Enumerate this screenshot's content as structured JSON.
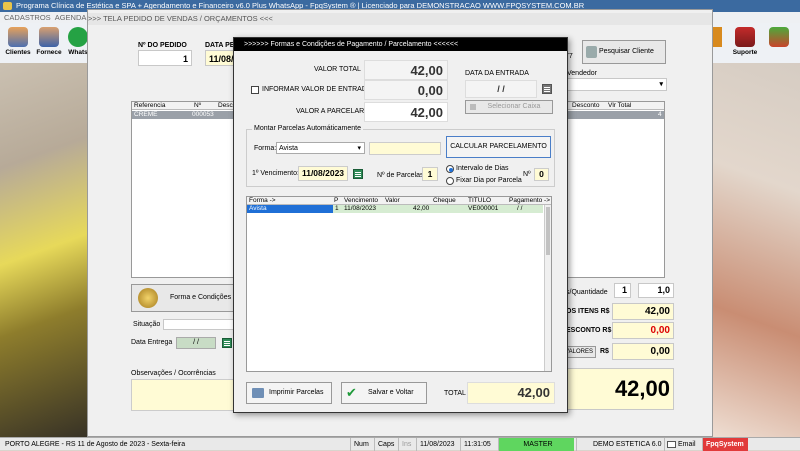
{
  "app": {
    "title": "Programa Clínica de Estética e SPA + Agendamento e Financeiro v6.0 Plus WhatsApp - FpqSystem ® | Licenciado para  DEMONSTRACAO WWW.FPQSYSTEM.COM.BR",
    "menu": [
      "CADASTROS",
      "AGENDAM"
    ]
  },
  "toolbar": {
    "clientes": "Clientes",
    "fornece": "Fornece",
    "whats": "Whats",
    "suporte": "Suporte"
  },
  "main": {
    "header": ">>>   TELA PEDIDO DE VENDAS / ORÇAMENTOS   <<<",
    "pedido_label": "Nº DO PEDIDO",
    "pedido_value": "1",
    "data_label": "DATA PED",
    "data_value": "11/08/",
    "pesquisar": "Pesquisar Cliente",
    "num77": "77",
    "vendedor_label": "Vendedor",
    "cols": {
      "ref": "Referencia",
      "num": "Nº",
      "desc": "Descr",
      "desconto": "Desconto",
      "vltotal": "Vlr Total"
    },
    "row": {
      "ref": "CREME",
      "num": "000053",
      "tail": "4"
    },
    "forma_cond": "Forma e Condições de",
    "situacao": "Situação",
    "data_entrega": "Data Entrega",
    "data_entrega_val": "/  /",
    "obs": "Observações / Ocorrências",
    "qty_label": "s/Quantidade",
    "qty1": "1",
    "qty2": "1,0",
    "itens_label": "OS ITENS R$",
    "itens_val": "42,00",
    "desconto_label": "ESCONTO R$",
    "desconto_val": "0,00",
    "valores_label": "VALORES",
    "valores_sym": "R$",
    "valores_val": "0,00",
    "total_big": "42,00"
  },
  "dialog": {
    "title": ">>>>>> Formas e Condições de Pagamento / Parcelamento  <<<<<<",
    "valor_total_label": "VALOR TOTAL",
    "valor_total": "42,00",
    "informar_label": "INFORMAR VALOR DE ENTRADA",
    "entrada": "0,00",
    "valor_parcelar_label": "VALOR A PARCELAR",
    "valor_parcelar": "42,00",
    "data_entrada_label": "DATA DA ENTRADA",
    "data_entrada": "/  /",
    "selecionar_caixa": "Selecionar Caixa",
    "montar_label": "Montar Parcelas Automáticamente",
    "forma_label": "Forma:",
    "forma_value": "Avista",
    "calcular": "CALCULAR  PARCELAMENTO",
    "venc_label": "1º Vencimento:",
    "venc_value": "11/08/2023",
    "nparc_label": "Nº de Parcelas",
    "nparc_value": "1",
    "intervalo": "Intervalo de Dias",
    "fixo": "Fixar Dia por Parcela",
    "n_label": "Nº",
    "n_value": "0",
    "cols": {
      "forma": "Forma ->",
      "p": "P",
      "venc": "Vencimento",
      "valor": "Valor",
      "cheque": "Cheque",
      "titulo": "TITULO",
      "pagamento": "Pagamento ->"
    },
    "row": {
      "forma": "Avista",
      "p": "1",
      "venc": "11/08/2023",
      "valor": "42,00",
      "cheque": "",
      "titulo": "VE000001",
      "pagamento": "/  /"
    },
    "imprimir": "Imprimir Parcelas",
    "salvar": "Salvar e Voltar",
    "total_label": "TOTAL",
    "total_value": "42,00"
  },
  "status": {
    "city": "PORTO ALEGRE - RS 11 de Agosto de 2023 - Sexta-feira",
    "num": "Num",
    "caps": "Caps",
    "ins": "Ins",
    "date": "11/08/2023",
    "time": "11:31:05",
    "master": "MASTER",
    "demo": "DEMO ESTETICA 6.0",
    "email": "Email",
    "brand": "FpqSystem"
  }
}
